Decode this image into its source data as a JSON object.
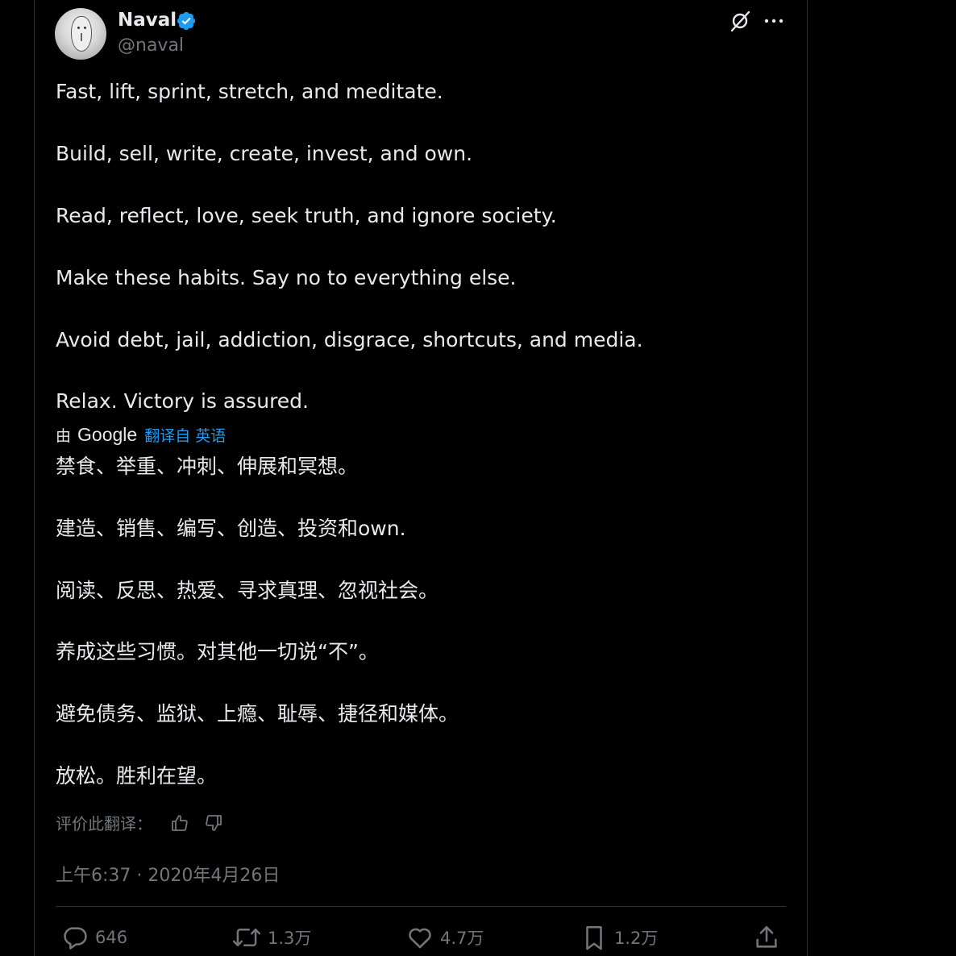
{
  "author": {
    "name": "Naval",
    "handle": "@naval",
    "verified": true,
    "verified_color": "#1d9bf0"
  },
  "tweet": {
    "lines": [
      "Fast, lift, sprint, stretch, and meditate.",
      "Build, sell, write, create, invest, and own.",
      "Read, reflect, love, seek truth, and ignore society.",
      "Make these habits. Say no to everything else.",
      "Avoid debt, jail, addiction, disgrace, shortcuts, and media.",
      "Relax. Victory is assured."
    ]
  },
  "translation": {
    "by_label": "由",
    "provider": "Google",
    "link_text": "翻译自 英语",
    "lines": [
      "禁食、举重、冲刺、伸展和冥想。",
      "建造、销售、编写、创造、投资和own.",
      "阅读、反思、热爱、寻求真理、忽视社会。",
      "养成这些习惯。对其他一切说“不”。",
      "避免债务、监狱、上瘾、耻辱、捷径和媒体。",
      "放松。胜利在望。"
    ],
    "rate_label": "评价此翻译："
  },
  "timestamp": "上午6:37 · 2020年4月26日",
  "actions": {
    "replies": "646",
    "reposts": "1.3万",
    "likes": "4.7万",
    "bookmarks": "1.2万"
  },
  "icons": [
    "grok-icon",
    "more-icon",
    "thumbs-up-icon",
    "thumbs-down-icon",
    "reply-icon",
    "repost-icon",
    "like-icon",
    "bookmark-icon",
    "share-icon"
  ]
}
